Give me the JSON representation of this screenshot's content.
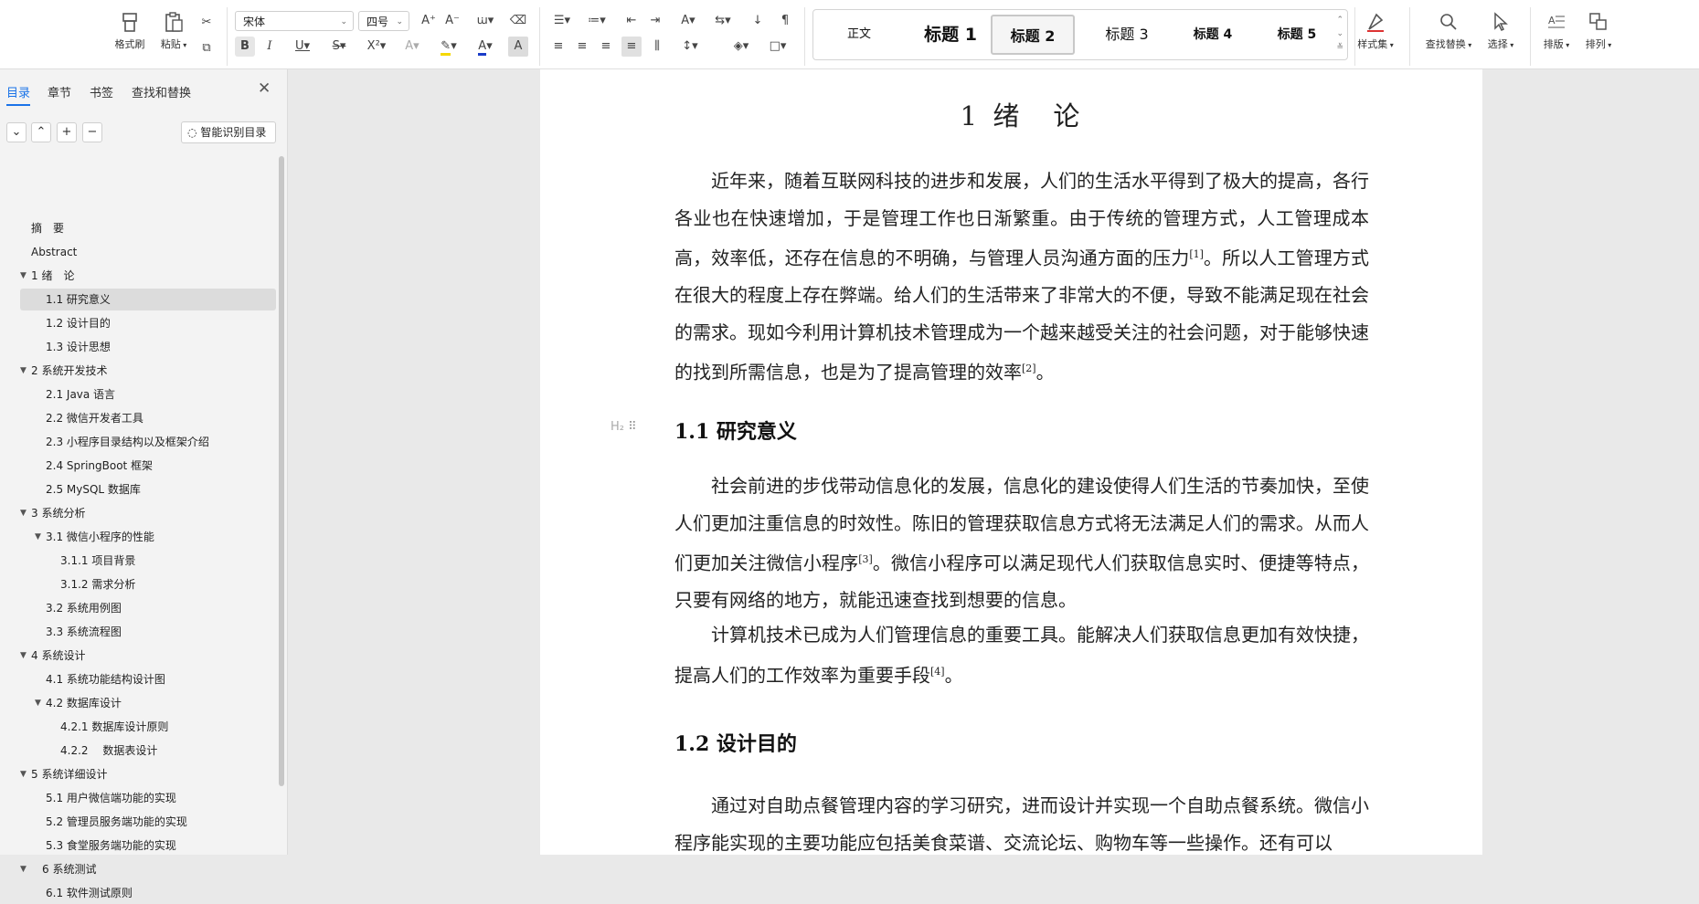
{
  "ribbon": {
    "clipboard": {
      "format_painter": "格式刷",
      "paste": "粘贴"
    },
    "font": {
      "name": "宋体",
      "size": "四号"
    },
    "styles": [
      "正文",
      "标题 1",
      "标题 2",
      "标题 3",
      "标题 4",
      "标题 5"
    ],
    "selected_style": "标题 2",
    "right": {
      "style_set": "样式集",
      "find_replace": "查找替换",
      "select": "选择",
      "layout": "排版",
      "arrange": "排列"
    }
  },
  "nav": {
    "tabs": [
      "目录",
      "章节",
      "书签",
      "查找和替换"
    ],
    "smart_toc": "智能识别目录",
    "toc": [
      {
        "label": "摘　要",
        "level": 0,
        "caret": false
      },
      {
        "label": "Abstract",
        "level": 0,
        "caret": false
      },
      {
        "label": "1 绪　论",
        "level": 0,
        "caret": true
      },
      {
        "label": "1.1 研究意义",
        "level": 1,
        "caret": false,
        "selected": true
      },
      {
        "label": "1.2 设计目的",
        "level": 1,
        "caret": false
      },
      {
        "label": "1.3 设计思想",
        "level": 1,
        "caret": false
      },
      {
        "label": "2 系统开发技术",
        "level": 0,
        "caret": true
      },
      {
        "label": "2.1 Java 语言",
        "level": 1,
        "caret": false
      },
      {
        "label": "2.2 微信开发者工具",
        "level": 1,
        "caret": false
      },
      {
        "label": "2.3 小程序目录结构以及框架介绍",
        "level": 1,
        "caret": false
      },
      {
        "label": "2.4 SpringBoot 框架",
        "level": 1,
        "caret": false
      },
      {
        "label": "2.5 MySQL 数据库",
        "level": 1,
        "caret": false
      },
      {
        "label": "3 系统分析",
        "level": 0,
        "caret": true
      },
      {
        "label": "3.1 微信小程序的性能",
        "level": 1,
        "caret": true
      },
      {
        "label": "3.1.1 项目背景",
        "level": 2,
        "caret": false
      },
      {
        "label": "3.1.2 需求分析",
        "level": 2,
        "caret": false
      },
      {
        "label": "3.2 系统用例图",
        "level": 1,
        "caret": false
      },
      {
        "label": "3.3  系统流程图",
        "level": 1,
        "caret": false
      },
      {
        "label": "4  系统设计",
        "level": 0,
        "caret": true
      },
      {
        "label": "4.1 系统功能结构设计图",
        "level": 1,
        "caret": false
      },
      {
        "label": "4.2 数据库设计",
        "level": 1,
        "caret": true
      },
      {
        "label": "4.2.1 数据库设计原则",
        "level": 2,
        "caret": false
      },
      {
        "label": "4.2.2　 数据表设计",
        "level": 2,
        "caret": false
      },
      {
        "label": "5 系统详细设计",
        "level": 0,
        "caret": true
      },
      {
        "label": "5.1 用户微信端功能的实现",
        "level": 1,
        "caret": false
      },
      {
        "label": "5.2 管理员服务端功能的实现",
        "level": 1,
        "caret": false
      },
      {
        "label": "5.3 食堂服务端功能的实现",
        "level": 1,
        "caret": false
      },
      {
        "label": "　6  系统测试",
        "level": 0,
        "caret": true
      },
      {
        "label": "6.1 软件测试原则",
        "level": 1,
        "caret": false
      }
    ]
  },
  "doc": {
    "title": "1 绪　论",
    "p1": "近年来，随着互联网科技的进步和发展，人们的生活水平得到了极大的提高，各行各业也在快速增加，于是管理工作也日渐繁重。由于传统的管理方式，人工管理成本高，效率低，还存在信息的不明确，与管理人员沟通方面的压力",
    "p1_ref1": "[1]",
    "p1_b": "。所以人工管理方式在很大的程度上存在弊端。给人们的生活带来了非常大的不便，导致不能满足现在社会的需求。现如今利用计算机技术管理成为一个越来越受关注的社会问题，对于能够快速的找到所需信息，也是为了提高管理的效率",
    "p1_ref2": "[2]",
    "p1_c": "。",
    "h2_1": "1.1 研究意义",
    "h_marker": "H₂",
    "p2": "社会前进的步伐带动信息化的发展，信息化的建设使得人们生活的节奏加快，至使人们更加注重信息的时效性。陈旧的管理获取信息方式将无法满足人们的需求。从而人们更加关注微信小程序",
    "p2_ref": "[3]",
    "p2_b": "。微信小程序可以满足现代人们获取信息实时、便捷等特点，只要有网络的地方，就能迅速查找到想要的信息。",
    "p3": "计算机技术已成为人们管理信息的重要工具。能解决人们获取信息更加有效快捷，提高人们的工作效率为重要手段",
    "p3_ref": "[4]",
    "p3_b": "。",
    "h2_2": "1.2 设计目的",
    "p4": "通过对自助点餐管理内容的学习研究，进而设计并实现一个自助点餐系统。微信小程序能实现的主要功能应包括美食菜谱、交流论坛、购物车等一些操作。还有可以"
  }
}
